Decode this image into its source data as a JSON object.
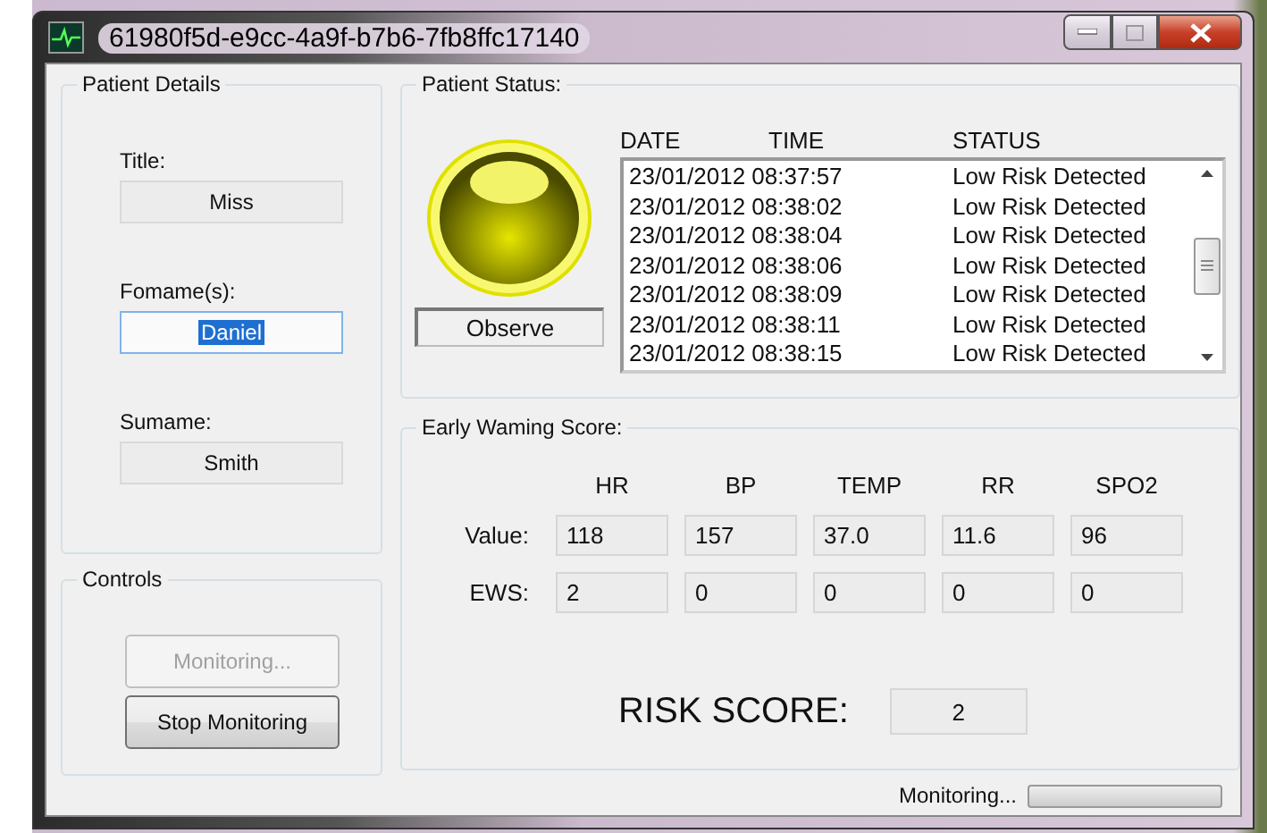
{
  "window": {
    "title": "61980f5d-e9cc-4a9f-b7b6-7fb8ffc17140"
  },
  "patient_details": {
    "title": "Patient Details",
    "fields": [
      {
        "label": "Title:",
        "value": "Miss",
        "focused": false
      },
      {
        "label": "Fomame(s):",
        "value": "Daniel",
        "focused": true
      },
      {
        "label": "Sumame:",
        "value": "Smith",
        "focused": false
      }
    ]
  },
  "controls": {
    "title": "Controls",
    "buttons": [
      {
        "label": "Monitoring...",
        "disabled": true
      },
      {
        "label": "Stop Monitoring",
        "disabled": false
      }
    ]
  },
  "patient_status": {
    "title": "Patient Status:",
    "status_label": "Observe",
    "log": {
      "columns": [
        "DATE",
        "TIME",
        "STATUS"
      ],
      "rows": [
        {
          "datetime": "23/01/2012 08:37:57",
          "status": "Low Risk Detected"
        },
        {
          "datetime": "23/01/2012 08:38:02",
          "status": "Low Risk Detected"
        },
        {
          "datetime": "23/01/2012 08:38:04",
          "status": "Low Risk Detected"
        },
        {
          "datetime": "23/01/2012 08:38:06",
          "status": "Low Risk Detected"
        },
        {
          "datetime": "23/01/2012 08:38:09",
          "status": "Low Risk Detected"
        },
        {
          "datetime": "23/01/2012 08:38:11",
          "status": "Low Risk Detected"
        },
        {
          "datetime": "23/01/2012 08:38:15",
          "status": "Low Risk Detected"
        }
      ]
    }
  },
  "early_warning_score": {
    "title": "Early Waming Score:",
    "columns": [
      "HR",
      "BP",
      "TEMP",
      "RR",
      "SPO2"
    ],
    "rows": [
      {
        "label": "Value:",
        "cells": [
          "118",
          "157",
          "37.0",
          "11.6",
          "96"
        ]
      },
      {
        "label": "EWS:",
        "cells": [
          "2",
          "0",
          "0",
          "0",
          "0"
        ]
      }
    ],
    "risk_score": {
      "label": "RISK SCORE:",
      "value": "2"
    }
  },
  "status_bar": {
    "text": "Monitoring...",
    "progress": {
      "level": 0.0
    }
  }
}
